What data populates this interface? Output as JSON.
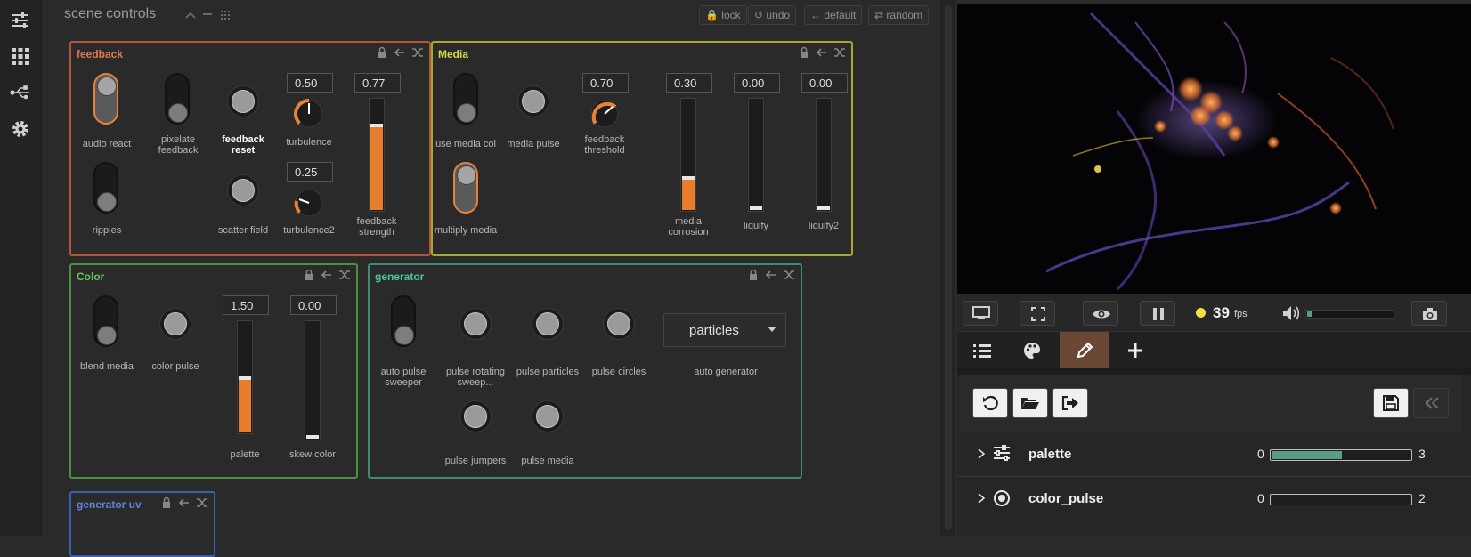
{
  "header": {
    "title": "scene controls",
    "buttons": {
      "lock": "lock",
      "undo": "undo",
      "default": "default",
      "random": "random"
    }
  },
  "sidebar": {
    "items": [
      {
        "icon": "sliders-icon"
      },
      {
        "icon": "grid-icon"
      },
      {
        "icon": "usb-icon"
      },
      {
        "icon": "gear-icon"
      }
    ]
  },
  "panels": {
    "feedback": {
      "title": "feedback",
      "color": "#b0573a",
      "audio_react": {
        "label": "audio react",
        "on": true
      },
      "pixelate_feedback": {
        "label": "pixelate feedback",
        "on": false
      },
      "feedback_reset": {
        "label": "feedback reset"
      },
      "turbulence": {
        "label": "turbulence",
        "value": "0.50"
      },
      "feedback_strength": {
        "label": "feedback strength",
        "value": "0.77",
        "level": 0.77
      },
      "ripples": {
        "label": "ripples",
        "on": false
      },
      "scatter_field": {
        "label": "scatter field"
      },
      "turbulence2": {
        "label": "turbulence2",
        "value": "0.25"
      }
    },
    "media": {
      "title": "Media",
      "color": "#b8b83e",
      "use_media_col": {
        "label": "use media col",
        "on": false
      },
      "media_pulse": {
        "label": "media pulse"
      },
      "feedback_threshold": {
        "label": "feedback threshold",
        "value": "0.70"
      },
      "media_corrosion": {
        "label": "media corrosion",
        "value": "0.30",
        "level": 0.3
      },
      "liquify": {
        "label": "liquify",
        "value": "0.00",
        "level": 0.0
      },
      "liquify2": {
        "label": "liquify2",
        "value": "0.00",
        "level": 0.0
      },
      "multiply_media": {
        "label": "multiply media",
        "on": true
      }
    },
    "color": {
      "title": "Color",
      "color": "#4fa04a",
      "blend_media": {
        "label": "blend media",
        "on": false
      },
      "color_pulse": {
        "label": "color pulse"
      },
      "palette": {
        "label": "palette",
        "value": "1.50",
        "level": 0.5
      },
      "skew_color": {
        "label": "skew color",
        "value": "0.00",
        "level": 0.0
      }
    },
    "generator": {
      "title": "generator",
      "color": "#3e9a7e",
      "auto_pulse_sweeper": {
        "label": "auto pulse sweeper",
        "on": false
      },
      "pulse_rotating_sweep": {
        "label": "pulse rotating sweep..."
      },
      "pulse_particles": {
        "label": "pulse particles"
      },
      "pulse_circles": {
        "label": "pulse circles"
      },
      "auto_generator": {
        "label": "auto generator",
        "selected": "particles"
      },
      "pulse_jumpers": {
        "label": "pulse jumpers"
      },
      "pulse_media": {
        "label": "pulse media"
      }
    },
    "generator_uv": {
      "title": "generator uv",
      "color": "#3b5fb0"
    }
  },
  "player": {
    "fps_value": "39",
    "fps_unit": "fps",
    "volume_level": 0.05
  },
  "tabs": [
    {
      "icon": "list-icon"
    },
    {
      "icon": "palette-icon"
    },
    {
      "icon": "pencil-icon",
      "active": true
    },
    {
      "icon": "plus-icon"
    }
  ],
  "params": [
    {
      "name": "palette",
      "min": "0",
      "max": "3",
      "value": 1.5,
      "icon": "sliders-icon"
    },
    {
      "name": "color_pulse",
      "min": "0",
      "max": "2",
      "value": 0,
      "icon": "radio-icon"
    }
  ]
}
